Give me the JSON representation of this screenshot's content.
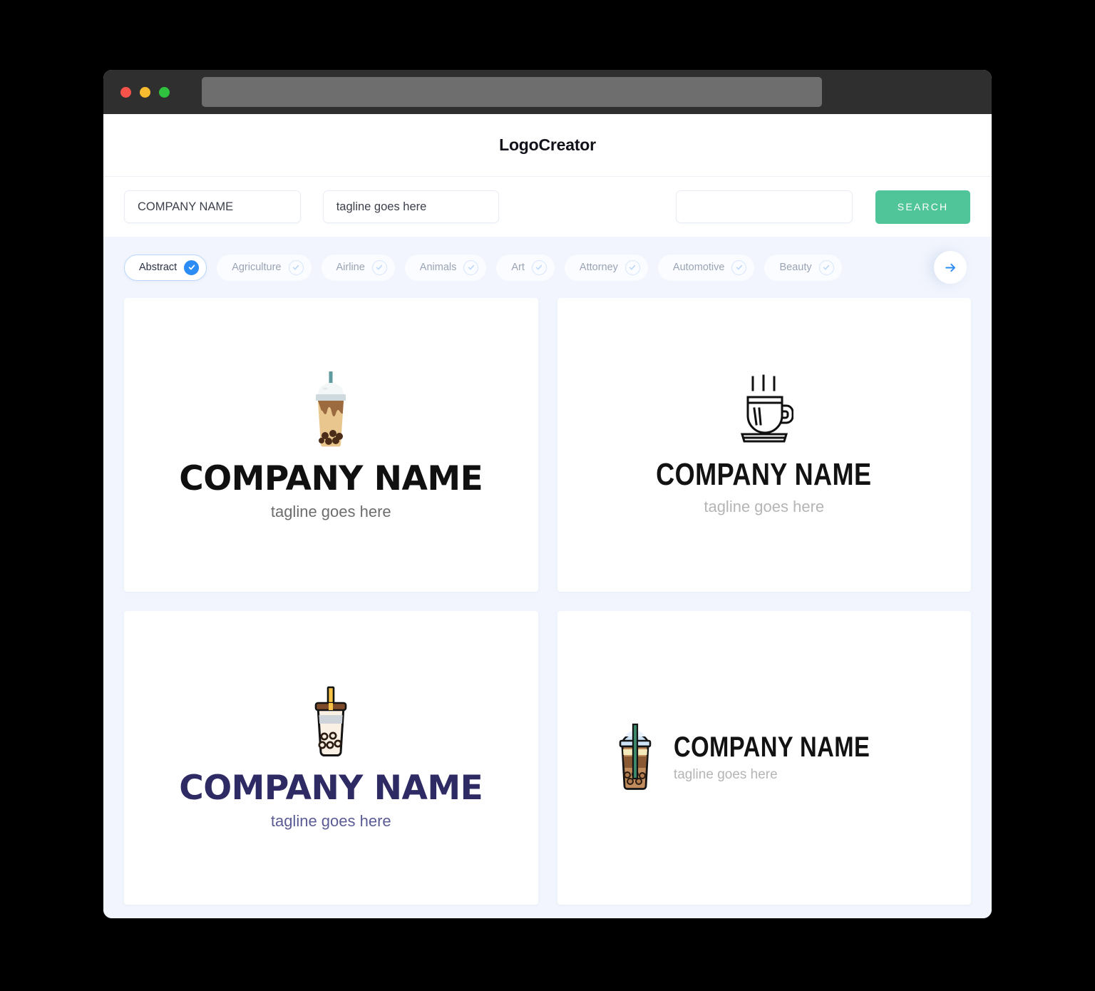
{
  "window": {
    "traffic_lights": [
      "close",
      "minimize",
      "maximize"
    ],
    "url_value": ""
  },
  "header": {
    "brand": "LogoCreator"
  },
  "toolbar": {
    "company_input": {
      "value": "COMPANY NAME",
      "placeholder": "COMPANY NAME"
    },
    "tagline_input": {
      "value": "tagline goes here",
      "placeholder": "tagline goes here"
    },
    "keyword_input": {
      "value": "",
      "placeholder": ""
    },
    "search_label": "SEARCH",
    "search_color": "#51c59a"
  },
  "categories": {
    "next_arrow_icon": "arrow-right-icon",
    "selected_color": "#2b8cf5",
    "items": [
      {
        "label": "Abstract",
        "selected": true
      },
      {
        "label": "Agriculture",
        "selected": false
      },
      {
        "label": "Airline",
        "selected": false
      },
      {
        "label": "Animals",
        "selected": false
      },
      {
        "label": "Art",
        "selected": false
      },
      {
        "label": "Attorney",
        "selected": false
      },
      {
        "label": "Automotive",
        "selected": false
      },
      {
        "label": "Beauty",
        "selected": false
      }
    ]
  },
  "results": [
    {
      "icon": "bubble-tea-cup-flat-icon",
      "name": "COMPANY NAME",
      "tagline": "tagline goes here",
      "layout": "stacked",
      "name_color": "#101010",
      "tagline_color": "#6d6d6d"
    },
    {
      "icon": "coffee-cup-saucer-line-icon",
      "name": "COMPANY NAME",
      "tagline": "tagline goes here",
      "layout": "stacked",
      "name_color": "#121212",
      "tagline_color": "#b5b5b5"
    },
    {
      "icon": "bubble-tea-cup-outline-icon",
      "name": "COMPANY NAME",
      "tagline": "tagline goes here",
      "layout": "stacked",
      "name_color": "#2e2a63",
      "tagline_color": "#5b5b96"
    },
    {
      "icon": "bubble-tea-cup-blue-lid-icon",
      "name": "COMPANY NAME",
      "tagline": "tagline goes here",
      "layout": "horizontal",
      "name_color": "#121212",
      "tagline_color": "#b5b5b5"
    }
  ]
}
